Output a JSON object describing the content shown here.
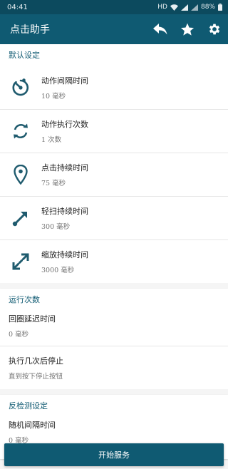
{
  "status_bar": {
    "time": "04:41",
    "hd": "HD",
    "battery": "88%"
  },
  "app_bar": {
    "title": "点击助手",
    "actions": [
      "back-arrow-icon",
      "star-icon",
      "gear-icon"
    ]
  },
  "sections": {
    "defaults": {
      "header": "默认设定",
      "items": [
        {
          "title": "动作间隔时间",
          "value": "10 毫秒",
          "icon": "timer-icon"
        },
        {
          "title": "动作执行次数",
          "value": "1 次数",
          "icon": "repeat-icon"
        },
        {
          "title": "点击持续时间",
          "value": "75 毫秒",
          "icon": "location-pin-icon"
        },
        {
          "title": "轻扫持续时间",
          "value": "300 毫秒",
          "icon": "swipe-arrow-icon"
        },
        {
          "title": "缩放持续时间",
          "value": "3000 毫秒",
          "icon": "pinch-arrows-icon"
        }
      ]
    },
    "run_count": {
      "header": "运行次数",
      "items": [
        {
          "title": "回圈延迟时间",
          "value": "0 毫秒"
        },
        {
          "title": "执行几次后停止",
          "value": "直到按下停止按钮"
        }
      ]
    },
    "anti_detect": {
      "header": "反检测设定",
      "items": [
        {
          "title": "随机间隔时间",
          "value": "0 毫秒"
        }
      ]
    }
  },
  "start_button": {
    "label": "开始服务"
  },
  "colors": {
    "primary": "#0f5a72",
    "status_bar": "#0c4a5e",
    "icon": "#1f5b6e"
  }
}
